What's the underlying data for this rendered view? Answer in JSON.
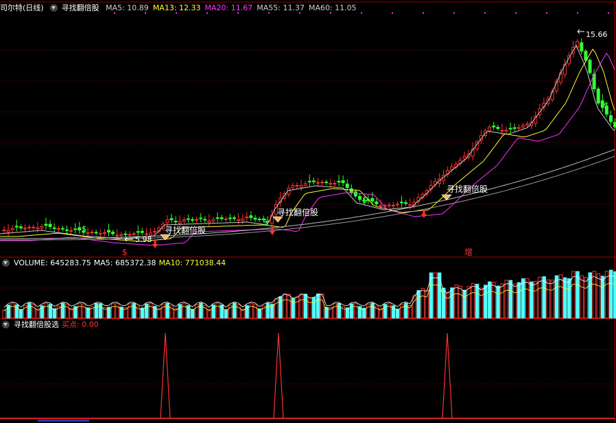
{
  "main_panel": {
    "title": "司尔特(日线)",
    "indicator": "寻找翻倍股",
    "ma": [
      {
        "label": "MA5: 10.89",
        "color": "#cccccc"
      },
      {
        "label": "MA13: 12.33",
        "color": "#ffff33"
      },
      {
        "label": "MA20: 11.67",
        "color": "#ff33ff"
      },
      {
        "label": "MA55: 11.37",
        "color": "#cccccc"
      },
      {
        "label": "MA60: 11.05",
        "color": "#cccccc"
      }
    ],
    "high_label": "15.66",
    "low_label": "5.98",
    "signal_label": "寻找翻倍股",
    "marker_s": "$",
    "marker_zeng": "增"
  },
  "volume_panel": {
    "label": "VOLUME: 645283.75",
    "ma5": "MA5: 685372.38",
    "ma10": "MA10: 771038.44"
  },
  "signal_panel": {
    "label": "寻找翻倍股选",
    "buy": "买点: 0.00"
  },
  "colors": {
    "up": "#ff3232",
    "down": "#54ffff",
    "green": "#33ff33",
    "grid": "#8b0000"
  },
  "chart_data": {
    "type": "candlestick",
    "price_high": 15.66,
    "price_low": 5.98,
    "signal_count": 3
  }
}
